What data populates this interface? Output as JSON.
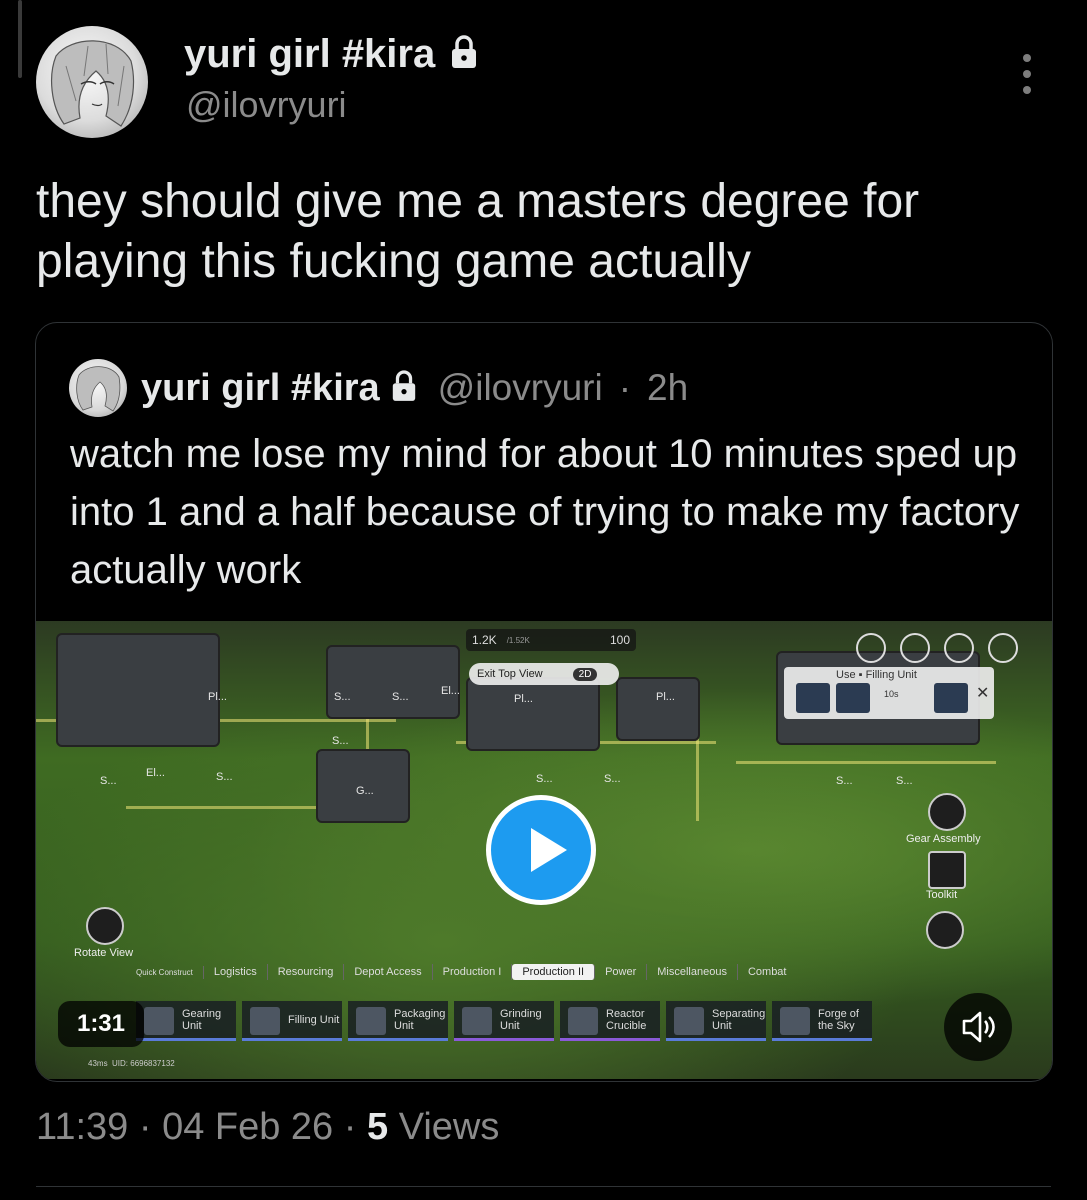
{
  "tweet": {
    "display_name": "yuri girl #kira",
    "handle": "@ilovryuri",
    "text": "they should give me a masters degree for playing this fucking game actually",
    "timestamp": "11:39",
    "date": "04 Feb 26",
    "views_count": "5",
    "views_label": "Views",
    "separator": "·"
  },
  "quoted": {
    "display_name": "yuri girl #kira",
    "handle": "@ilovryuri",
    "age": "2h",
    "separator": "·",
    "text": "watch me lose my mind for about 10 minutes sped up into 1 and a half because of trying to make my factory actually work",
    "video": {
      "duration": "1:31",
      "hud": {
        "resource": "1.2K",
        "resource_max": "/1.52K",
        "percent": "100",
        "exit_view": "Exit Top View",
        "view_mode": "2D",
        "use_title": "Use",
        "use_unit": "Filling Unit",
        "timer": "10s",
        "gear_assembly": "Gear Assembly",
        "toolkit": "Toolkit",
        "rotate_view": "Rotate View",
        "ping": "43ms",
        "uid": "UID: 6696837132",
        "building_labels": [
          "Pl...",
          "S...",
          "S...",
          "El...",
          "Pl...",
          "Pl...",
          "S...",
          "S...",
          "El...",
          "S...",
          "G...",
          "S...",
          "S...",
          "S...",
          "S..."
        ],
        "categories": [
          "Quick Construct",
          "Logistics",
          "Resourcing",
          "Depot Access",
          "Production I",
          "Production II",
          "Power",
          "Miscellaneous",
          "Combat"
        ],
        "selected_category": "Production II",
        "units": [
          "Gearing Unit",
          "Filling Unit",
          "Packaging Unit",
          "Grinding Unit",
          "Reactor Crucible",
          "Separating Unit",
          "Forge of the Sky"
        ]
      }
    }
  },
  "colors": {
    "background": "#000000",
    "text_primary": "#e7e9ea",
    "text_secondary": "#8b8b8b",
    "accent": "#1d9bf0",
    "border": "#2f3336"
  },
  "icons": [
    "lock-icon",
    "more-icon",
    "play-icon",
    "volume-icon"
  ]
}
